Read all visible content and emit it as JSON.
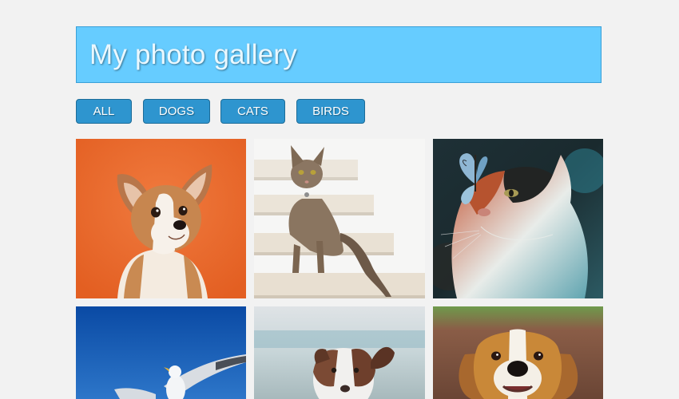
{
  "header": {
    "title": "My photo gallery",
    "background": "#66ccff"
  },
  "filters": {
    "accent": "#2e95cf",
    "items": [
      {
        "id": "all",
        "label": "ALL"
      },
      {
        "id": "dogs",
        "label": "DOGS"
      },
      {
        "id": "cats",
        "label": "CATS"
      },
      {
        "id": "birds",
        "label": "BIRDS"
      }
    ]
  },
  "gallery": {
    "photos": [
      {
        "category": "dogs",
        "subject": "corgi puppy on orange background"
      },
      {
        "category": "cats",
        "subject": "tabby cat sitting on white stairs"
      },
      {
        "category": "cats",
        "subject": "cat with butterfly on nose"
      },
      {
        "category": "birds",
        "subject": "seagull flying in blue sky"
      },
      {
        "category": "dogs",
        "subject": "australian shepherd dog"
      },
      {
        "category": "dogs",
        "subject": "beagle dog on grass"
      }
    ]
  }
}
